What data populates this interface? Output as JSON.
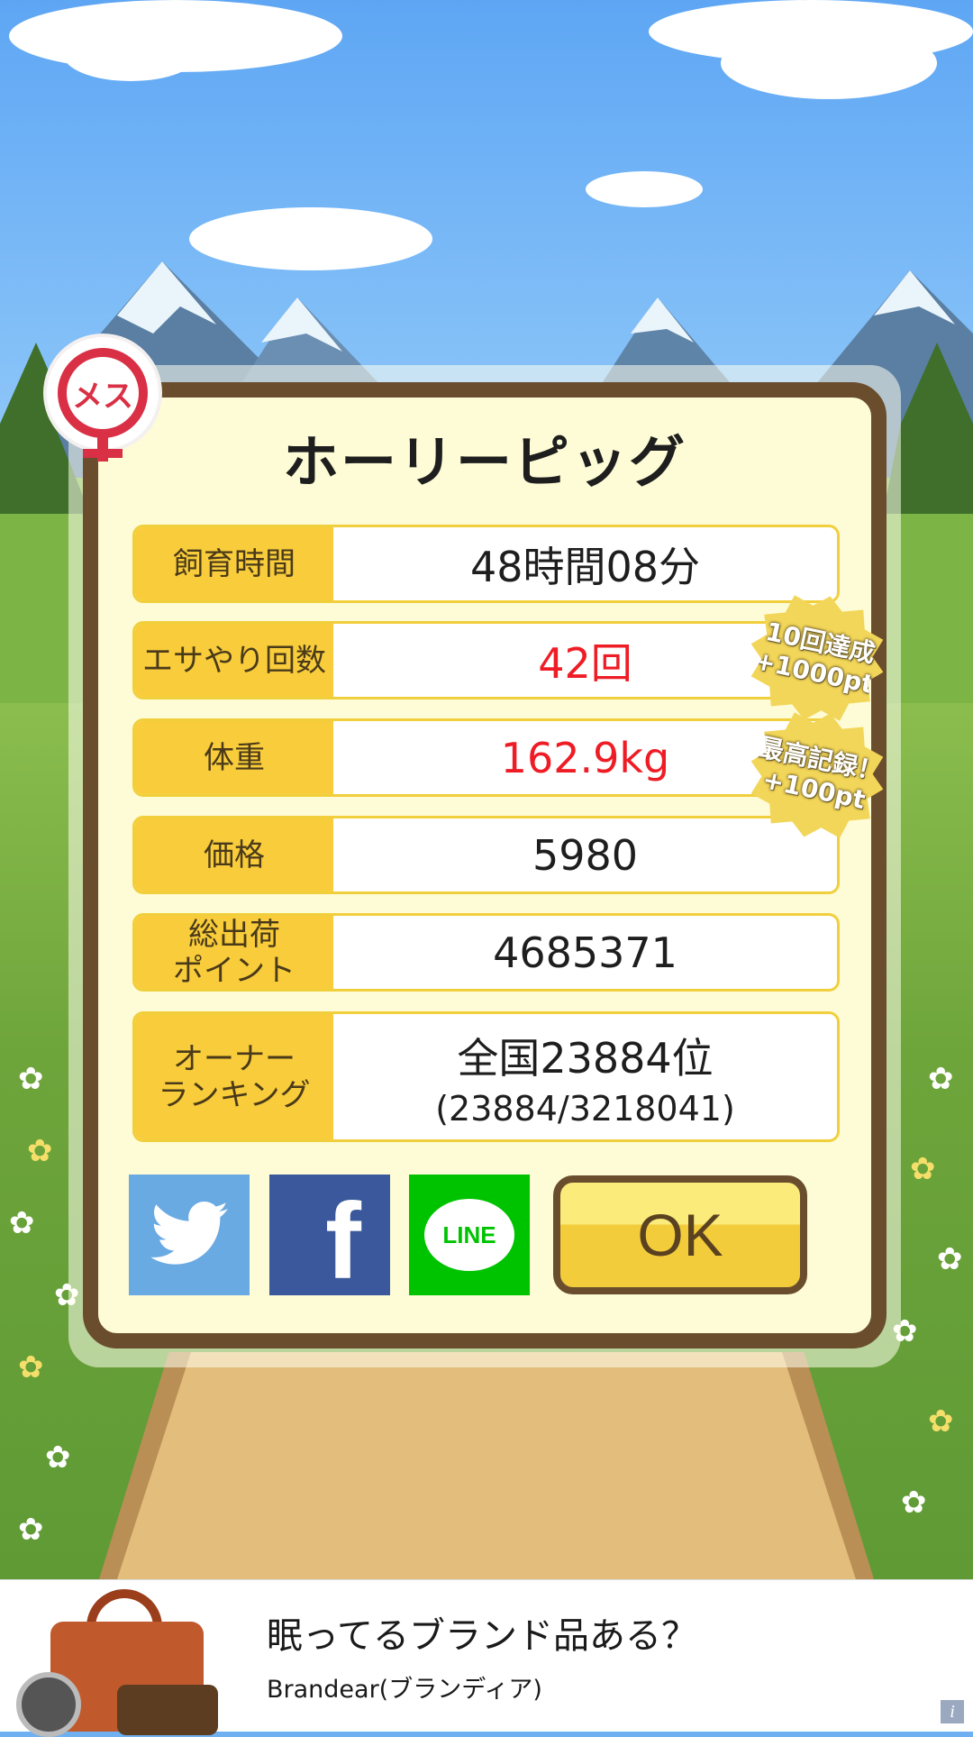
{
  "pig_name": "ホーリーピッグ",
  "sex_badge": "メス",
  "stats": [
    {
      "label": "飼育時間",
      "value": "48時間08分"
    },
    {
      "label": "エサやり回数",
      "value": "42回"
    },
    {
      "label": "体重",
      "value": "162.9kg"
    },
    {
      "label": "価格",
      "value": "5980"
    },
    {
      "label": "総出荷\nポイント",
      "value": "4685371"
    },
    {
      "label": "オーナー\nランキング",
      "value": "全国23884位",
      "sub": "(23884/3218041)"
    }
  ],
  "medals": [
    {
      "line1": "10回達成",
      "line2": "+1000pt"
    },
    {
      "line1": "最高記録！",
      "line2": "+100pt"
    }
  ],
  "share": {
    "twitter": "twitter-bird-icon",
    "facebook": "f",
    "line": "LINE"
  },
  "ok_label": "OK",
  "ad": {
    "title": "眠ってるブランド品ある？",
    "advertiser": "Brandear(ブランディア)",
    "info": "i"
  },
  "colors": {
    "accent_red": "#ee1c25",
    "label_yellow": "#f8cc3a",
    "frame_brown": "#6a4d2d",
    "twitter": "#6aaae2",
    "facebook": "#3a589b",
    "line": "#00c300"
  }
}
